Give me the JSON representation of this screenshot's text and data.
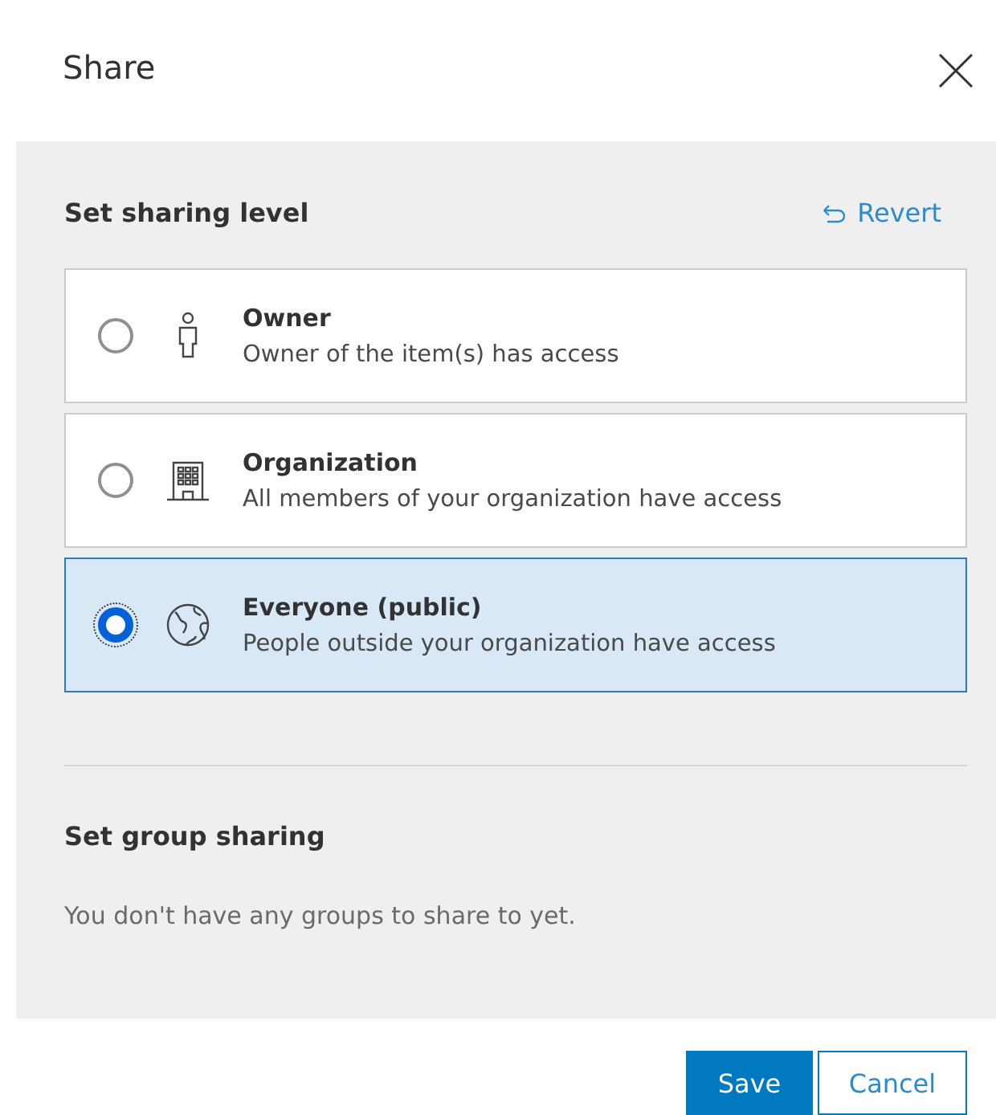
{
  "dialog": {
    "title": "Share"
  },
  "sharing_level": {
    "heading": "Set sharing level",
    "revert": "Revert",
    "options": [
      {
        "kind": "person",
        "label": "Owner",
        "description": "Owner of the item(s) has access",
        "selected": false
      },
      {
        "kind": "building",
        "label": "Organization",
        "description": "All members of your organization have access",
        "selected": false
      },
      {
        "kind": "globe",
        "label": "Everyone (public)",
        "description": "People outside your organization have access",
        "selected": true
      }
    ]
  },
  "group_sharing": {
    "heading": "Set group sharing",
    "message": "You don't have any groups to share to yet."
  },
  "buttons": [
    {
      "kind": "primary",
      "label": "Save"
    },
    {
      "kind": "secondary",
      "label": "Cancel"
    }
  ]
}
